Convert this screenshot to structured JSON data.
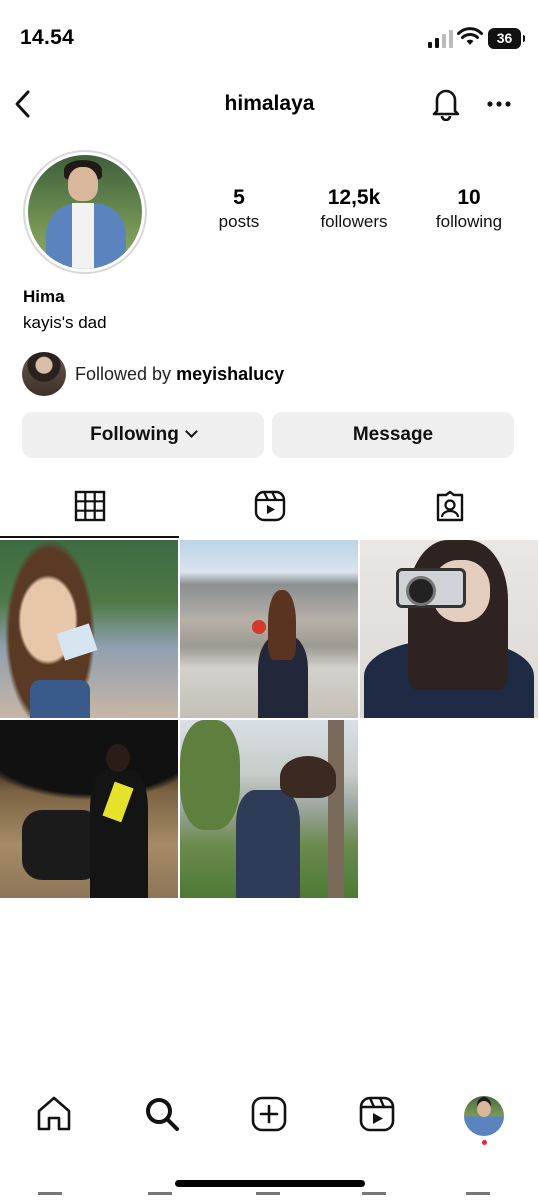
{
  "status_bar": {
    "time": "14.54",
    "battery": "36",
    "icons": [
      "cellular-signal-icon",
      "wifi-icon",
      "battery-icon"
    ]
  },
  "header": {
    "username": "himalaya",
    "icons": [
      "back-arrow-icon",
      "bell-icon",
      "more-icon"
    ]
  },
  "profile": {
    "stats": [
      {
        "value": "5",
        "label": "posts"
      },
      {
        "value": "12,5k",
        "label": "followers"
      },
      {
        "value": "10",
        "label": "following"
      }
    ],
    "display_name": "Hima",
    "bio": "kayis's dad",
    "followed_by_prefix": "Followed by",
    "followed_by_user": "meyishalucy"
  },
  "buttons": {
    "following": "Following",
    "message": "Message"
  },
  "tabs": [
    {
      "icon": "grid-icon",
      "active": true
    },
    {
      "icon": "reels-icon",
      "active": false
    },
    {
      "icon": "tagged-icon",
      "active": false
    }
  ],
  "posts_count_shown": 5,
  "bottom_nav": {
    "items": [
      "home-icon",
      "search-icon",
      "create-icon",
      "reels-icon",
      "profile-avatar"
    ],
    "notification_color": "#e8253a"
  }
}
